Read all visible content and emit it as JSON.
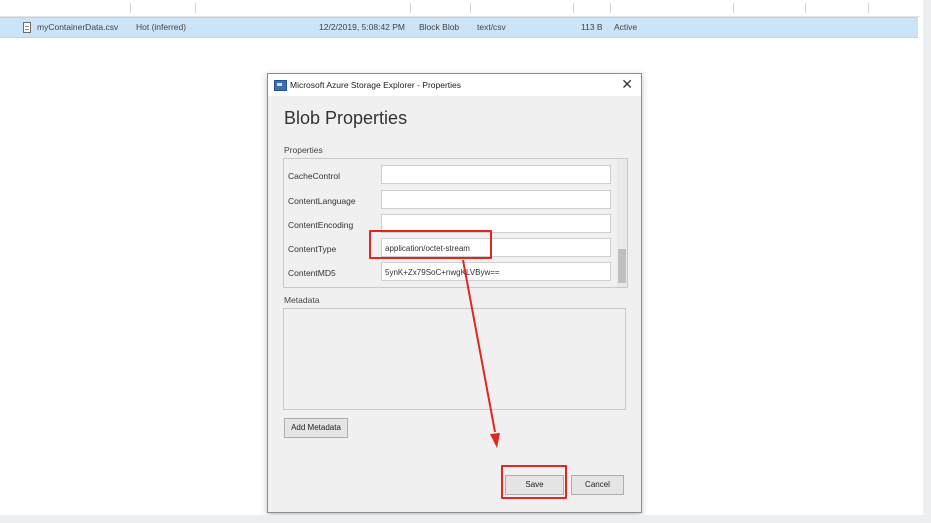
{
  "file_row": {
    "name": "myContainerData.csv",
    "tier": "Hot (inferred)",
    "modified": "12/2/2019, 5:08:42 PM",
    "blob_type": "Block Blob",
    "content_type": "text/csv",
    "size": "113 B",
    "status": "Active"
  },
  "dialog": {
    "title": "Microsoft Azure Storage Explorer - Properties",
    "close_glyph": "✕",
    "heading": "Blob Properties",
    "properties_label": "Properties",
    "properties": [
      {
        "label": "CacheControl",
        "value": ""
      },
      {
        "label": "ContentLanguage",
        "value": ""
      },
      {
        "label": "ContentEncoding",
        "value": ""
      },
      {
        "label": "ContentType",
        "value": "application/octet-stream"
      },
      {
        "label": "ContentMD5",
        "value": "5ynK+Zx79SoC+nwgKLVByw=="
      }
    ],
    "metadata_label": "Metadata",
    "add_metadata_label": "Add Metadata",
    "save_label": "Save",
    "cancel_label": "Cancel"
  },
  "colors": {
    "selection": "#cce4f7",
    "annotation_red": "#e0261e"
  }
}
